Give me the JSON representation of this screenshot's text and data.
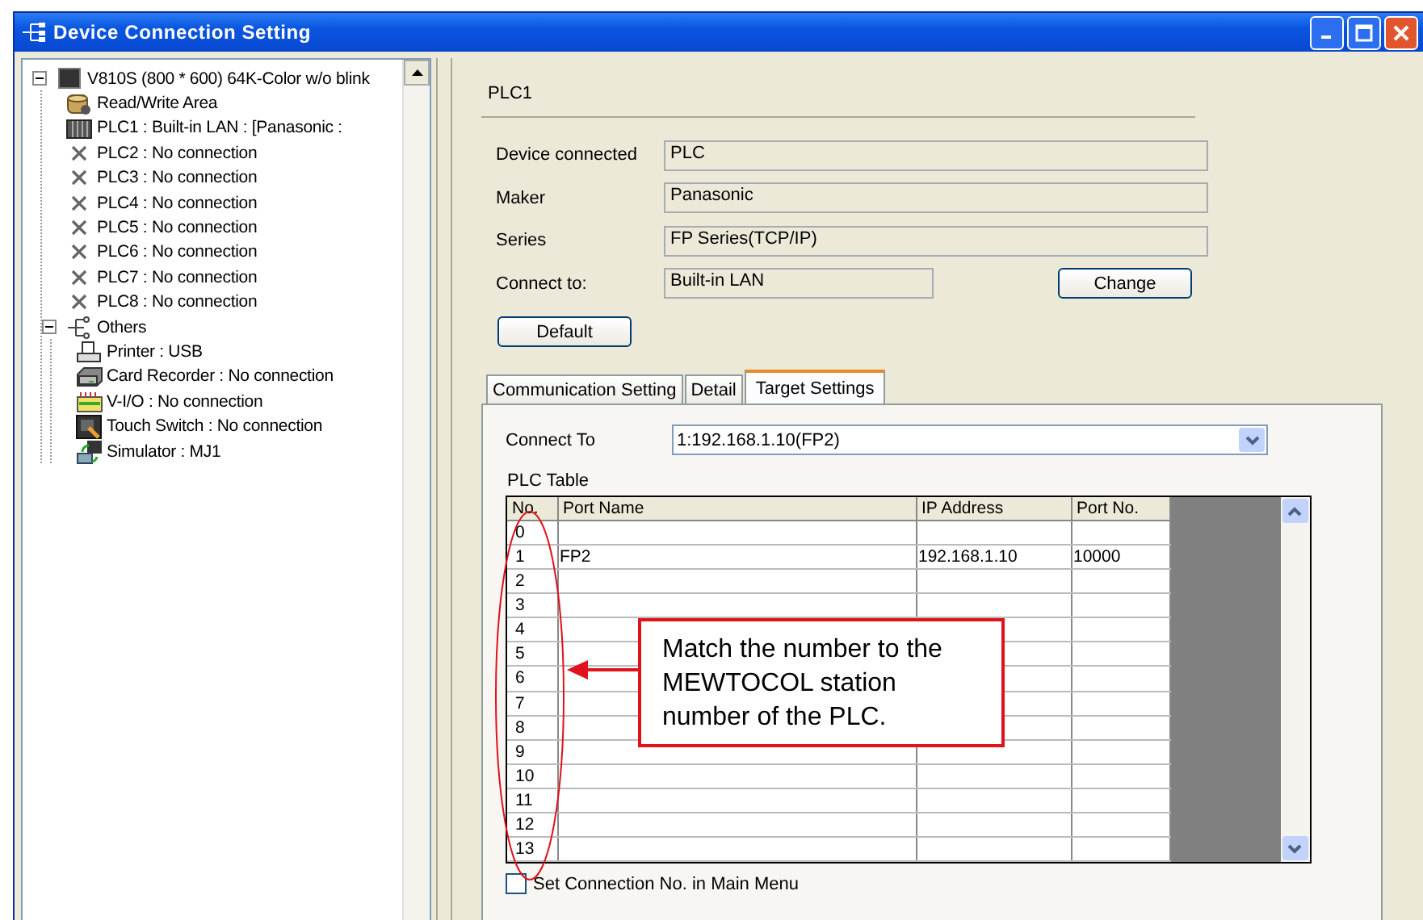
{
  "window": {
    "title": "Device Connection Setting"
  },
  "tree": [
    {
      "label": "V810S (800 * 600) 64K-Color w/o blink",
      "kind": "screen",
      "expanded": true,
      "children": [
        {
          "label": "Read/Write Area",
          "kind": "disk"
        },
        {
          "label": "PLC1 : Built-in LAN : [Panasonic :",
          "kind": "plc"
        },
        {
          "label": "PLC2 : No connection",
          "kind": "none"
        },
        {
          "label": "PLC3 : No connection",
          "kind": "none"
        },
        {
          "label": "PLC4 : No connection",
          "kind": "none"
        },
        {
          "label": "PLC5 : No connection",
          "kind": "none"
        },
        {
          "label": "PLC6 : No connection",
          "kind": "none"
        },
        {
          "label": "PLC7 : No connection",
          "kind": "none"
        },
        {
          "label": "PLC8 : No connection",
          "kind": "none"
        },
        {
          "label": "Others",
          "kind": "network",
          "expanded": true,
          "children": [
            {
              "label": "Printer : USB",
              "kind": "printer"
            },
            {
              "label": "Card Recorder : No connection",
              "kind": "card"
            },
            {
              "label": "V-I/O : No connection",
              "kind": "vio"
            },
            {
              "label": "Touch Switch : No connection",
              "kind": "touch"
            },
            {
              "label": "Simulator : MJ1",
              "kind": "sim"
            }
          ]
        }
      ]
    }
  ],
  "detail": {
    "title": "PLC1",
    "fields": [
      {
        "label": "Device connected",
        "value": "PLC"
      },
      {
        "label": "Maker",
        "value": "Panasonic"
      },
      {
        "label": "Series",
        "value": "FP Series(TCP/IP)"
      },
      {
        "label": "Connect to:",
        "value": "Built-in LAN"
      }
    ],
    "change_button": "Change",
    "default_button": "Default"
  },
  "tabs": [
    {
      "label": "Communication Setting",
      "selected": false
    },
    {
      "label": "Detail",
      "selected": false
    },
    {
      "label": "Target Settings",
      "selected": true
    }
  ],
  "connect_to": {
    "label": "Connect To",
    "value": "1:192.168.1.10(FP2)"
  },
  "plc_table": {
    "title": "PLC Table",
    "columns": [
      "No.",
      "Port Name",
      "IP Address",
      "Port No."
    ],
    "rows": [
      [
        "0",
        "",
        "",
        ""
      ],
      [
        "1",
        "FP2",
        "192.168.1.10",
        "10000"
      ],
      [
        "2",
        "",
        "",
        ""
      ],
      [
        "3",
        "",
        "",
        ""
      ],
      [
        "4",
        "",
        "",
        ""
      ],
      [
        "5",
        "",
        "",
        ""
      ],
      [
        "6",
        "",
        "",
        ""
      ],
      [
        "7",
        "",
        "",
        ""
      ],
      [
        "8",
        "",
        "",
        ""
      ],
      [
        "9",
        "",
        "",
        ""
      ],
      [
        "10",
        "",
        "",
        ""
      ],
      [
        "11",
        "",
        "",
        ""
      ],
      [
        "12",
        "",
        "",
        ""
      ],
      [
        "13",
        "",
        "",
        ""
      ]
    ]
  },
  "callout": "Match the number to the MEWTOCOL station number of the PLC.",
  "main_menu_checkbox": {
    "label": "Set Connection No. in Main Menu",
    "checked": false
  }
}
